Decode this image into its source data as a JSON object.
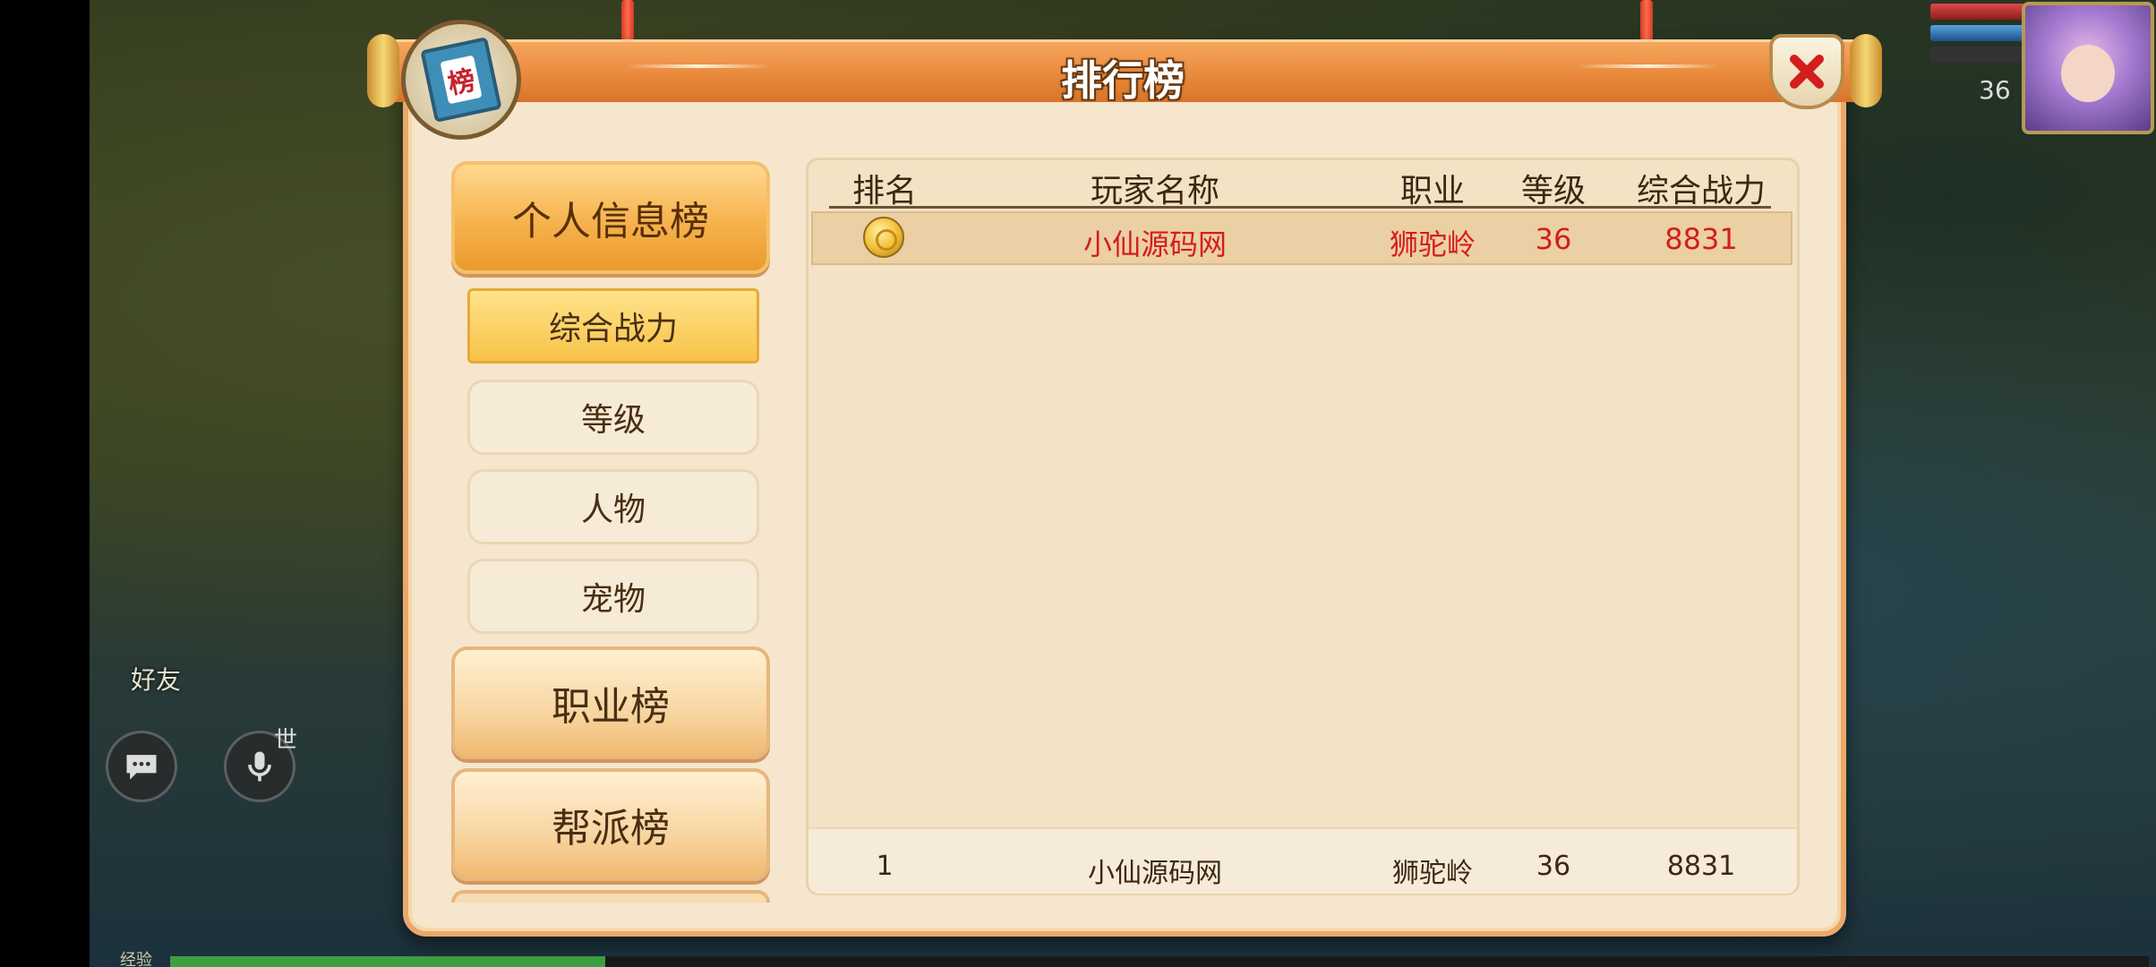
{
  "dialog": {
    "title": "排行榜",
    "badge_char": "榜"
  },
  "menu": {
    "main_items": [
      {
        "label": "个人信息榜",
        "active": true
      },
      {
        "label": "职业榜",
        "active": false
      },
      {
        "label": "帮派榜",
        "active": false
      }
    ],
    "sub_items": [
      {
        "label": "综合战力",
        "active": true
      },
      {
        "label": "等级",
        "active": false
      },
      {
        "label": "人物",
        "active": false
      },
      {
        "label": "宠物",
        "active": false
      }
    ]
  },
  "table": {
    "columns": [
      "排名",
      "玩家名称",
      "职业",
      "等级",
      "综合战力"
    ],
    "rows": [
      {
        "rank_icon": "gold-medal-icon",
        "name": "小仙源码网",
        "class": "狮驼岭",
        "level": "36",
        "power": "8831"
      }
    ],
    "self_row": {
      "rank": "1",
      "name": "小仙源码网",
      "class": "狮驼岭",
      "level": "36",
      "power": "8831"
    }
  },
  "hud": {
    "player_level": "36",
    "friend_label": "好友",
    "world_label": "世",
    "exp_label": "经验",
    "exp_progress": 0.22
  },
  "colors": {
    "highlight_text": "#d51d1d",
    "title_bar": "#e98a3c",
    "panel_bg": "#f5e6cd"
  }
}
